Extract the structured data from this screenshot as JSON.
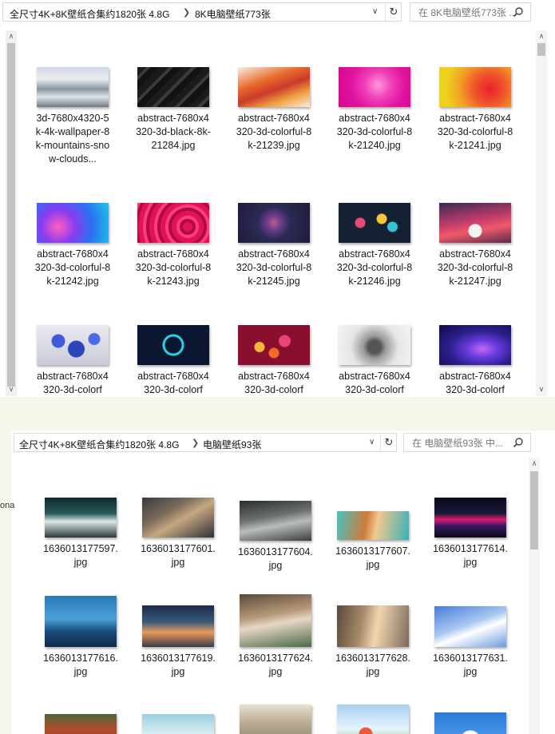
{
  "top": {
    "breadcrumb": [
      "全尺寸4K+8K壁纸合集约1820张 4.8G",
      "8K电脑壁纸773张"
    ],
    "search_placeholder": "在 8K电脑壁纸773张 ...",
    "files": [
      {
        "name": "3d-7680x4320-5k-4k-wallpaper-8k-mountains-snow-clouds...",
        "thumb": "mountains"
      },
      {
        "name": "abstract-7680x4320-3d-black-8k-21284.jpg",
        "thumb": "black"
      },
      {
        "name": "abstract-7680x4320-3d-colorful-8k-21239.jpg",
        "thumb": "orange"
      },
      {
        "name": "abstract-7680x4320-3d-colorful-8k-21240.jpg",
        "thumb": "magenta"
      },
      {
        "name": "abstract-7680x4320-3d-colorful-8k-21241.jpg",
        "thumb": "yellow"
      },
      {
        "name": "abstract-7680x4320-3d-colorful-8k-21242.jpg",
        "thumb": "bubbles"
      },
      {
        "name": "abstract-7680x4320-3d-colorful-8k-21243.jpg",
        "thumb": "pinkwave"
      },
      {
        "name": "abstract-7680x4320-3d-colorful-8k-21245.jpg",
        "thumb": "heart"
      },
      {
        "name": "abstract-7680x4320-3d-colorful-8k-21246.jpg",
        "thumb": "cubes"
      },
      {
        "name": "abstract-7680x4320-3d-colorful-8k-21247.jpg",
        "thumb": "pinkmtn"
      },
      {
        "name": "abstract-7680x4320-3d-colorf",
        "thumb": "balloons"
      },
      {
        "name": "abstract-7680x4320-3d-colorf",
        "thumb": "neonstar"
      },
      {
        "name": "abstract-7680x4320-3d-colorf",
        "thumb": "redcubes"
      },
      {
        "name": "abstract-7680x4320-3d-colorf",
        "thumb": "grey"
      },
      {
        "name": "abstract-7680x4320-3d-colorf",
        "thumb": "purple"
      }
    ]
  },
  "bottom": {
    "breadcrumb": [
      "全尺寸4K+8K壁纸合集约1820张 4.8G",
      "电脑壁纸93张"
    ],
    "search_placeholder": "在 电脑壁纸93张 中...",
    "side_text": "ona",
    "files": [
      {
        "name": "1636013177597.jpg",
        "thumb": "anime1"
      },
      {
        "name": "1636013177601.jpg",
        "thumb": "anime2"
      },
      {
        "name": "1636013177604.jpg",
        "thumb": "anime3"
      },
      {
        "name": "1636013177607.jpg",
        "thumb": "anime4"
      },
      {
        "name": "1636013177614.jpg",
        "thumb": "city"
      },
      {
        "name": "1636013177616.jpg",
        "thumb": "rain"
      },
      {
        "name": "1636013177619.jpg",
        "thumb": "lantern"
      },
      {
        "name": "1636013177624.jpg",
        "thumb": "girl"
      },
      {
        "name": "1636013177628.jpg",
        "thumb": "sleep"
      },
      {
        "name": "1636013177631.jpg",
        "thumb": "sky"
      },
      {
        "name": "",
        "thumb": "torii"
      },
      {
        "name": "",
        "thumb": "cloud1"
      },
      {
        "name": "",
        "thumb": "street"
      },
      {
        "name": "",
        "thumb": "flowers"
      },
      {
        "name": "",
        "thumb": "cloud2"
      }
    ]
  }
}
